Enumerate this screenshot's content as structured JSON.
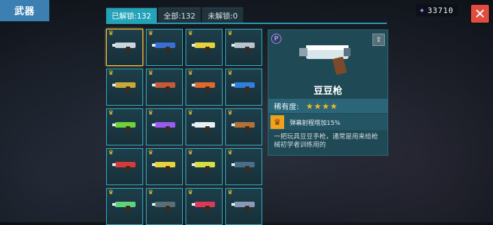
{
  "header": {
    "title": "武器"
  },
  "currency": {
    "amount": "33710",
    "icon": "purple-star-icon"
  },
  "close": {
    "icon": "close-icon",
    "label": "✕"
  },
  "tabs": [
    {
      "label": "已解锁:132",
      "active": true
    },
    {
      "label": "全部:132",
      "active": false
    },
    {
      "label": "未解锁:0",
      "active": false
    }
  ],
  "weapons": [
    {
      "icon": "peashooter-pistol-icon",
      "selected": true,
      "color": "#c9d6dc"
    },
    {
      "icon": "blue-blaster-icon",
      "color": "#3b6fd8"
    },
    {
      "icon": "tesla-gun-icon",
      "color": "#e8d23a"
    },
    {
      "icon": "silver-rifle-icon",
      "color": "#b8c4ce"
    },
    {
      "icon": "gold-smg-icon",
      "color": "#c8a93a"
    },
    {
      "icon": "coil-launcher-icon",
      "color": "#c65a38"
    },
    {
      "icon": "orange-shotgun-icon",
      "color": "#e06a2c"
    },
    {
      "icon": "blue-laser-icon",
      "color": "#2f7fe0"
    },
    {
      "icon": "green-alien-gun-icon",
      "color": "#6fd23a"
    },
    {
      "icon": "purple-crossbow-icon",
      "color": "#9a5bf0"
    },
    {
      "icon": "white-dart-icon",
      "color": "#e8eef2"
    },
    {
      "icon": "wooden-rifle-icon",
      "color": "#b07238"
    },
    {
      "icon": "red-cannon-icon",
      "color": "#d83a3a"
    },
    {
      "icon": "yellow-gatling-icon",
      "color": "#e8d23a"
    },
    {
      "icon": "drill-gun-icon",
      "color": "#d6e046"
    },
    {
      "icon": "dark-sniper-icon",
      "color": "#4a6d8c"
    },
    {
      "icon": "green-slime-gun-icon",
      "color": "#5fd27a"
    },
    {
      "icon": "black-rifle-icon",
      "color": "#5a6e78"
    },
    {
      "icon": "red-mech-gun-icon",
      "color": "#d83a58"
    },
    {
      "icon": "grey-orb-gun-icon",
      "color": "#8a98b8"
    }
  ],
  "detail": {
    "name": "豆豆枪",
    "rarity_label": "稀有度:",
    "rarity_stars": 4,
    "rarity_text": "★★★★",
    "perk_icon": "crown-shield-icon",
    "perk": "弹幕射程增加15%",
    "description": "一把玩具豆豆手枪，通常是用来给枪械初学者训练用的",
    "badge": "P",
    "share_icon": "share-icon"
  }
}
